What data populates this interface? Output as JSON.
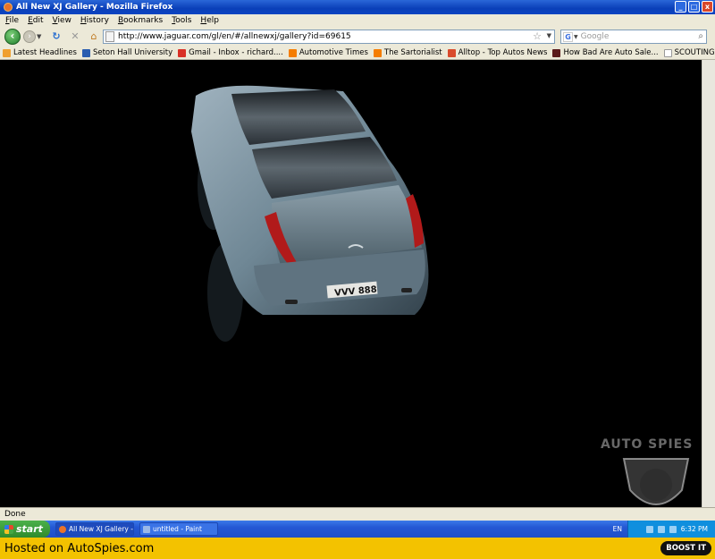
{
  "window": {
    "title": "All New XJ Gallery - Mozilla Firefox",
    "buttons": [
      "_",
      "□",
      "x"
    ]
  },
  "menu": [
    "File",
    "Edit",
    "View",
    "History",
    "Bookmarks",
    "Tools",
    "Help"
  ],
  "nav": {
    "url": "http://www.jaguar.com/gl/en/#/allnewxj/gallery?id=69615",
    "search_placeholder": "Google"
  },
  "bookmarks": [
    {
      "label": "Latest Headlines",
      "color": "#f0a030"
    },
    {
      "label": "Seton Hall University",
      "color": "#2a5db0"
    },
    {
      "label": "Gmail - Inbox - richard....",
      "color": "#d93025"
    },
    {
      "label": "Automotive Times",
      "color": "#f57d00"
    },
    {
      "label": "The Sartorialist",
      "color": "#f57d00"
    },
    {
      "label": "Alltop - Top Autos News",
      "color": "#d94a2b"
    },
    {
      "label": "How Bad Are Auto Sale...",
      "color": "#5a1a1a"
    },
    {
      "label": "SCOUTING NY - www.s...",
      "color": "#cccccc"
    }
  ],
  "content": {
    "plate": "VVV 888"
  },
  "status": "Done",
  "taskbar": {
    "start": "start",
    "tasks": [
      "All New XJ Gallery - M...",
      "untitled - Paint"
    ],
    "lang": "EN",
    "clock": "6:32 PM"
  },
  "watermark": "AUTO SPIES",
  "footer": {
    "text": "Hosted on AutoSpies.com",
    "badge": "BOOST IT"
  }
}
